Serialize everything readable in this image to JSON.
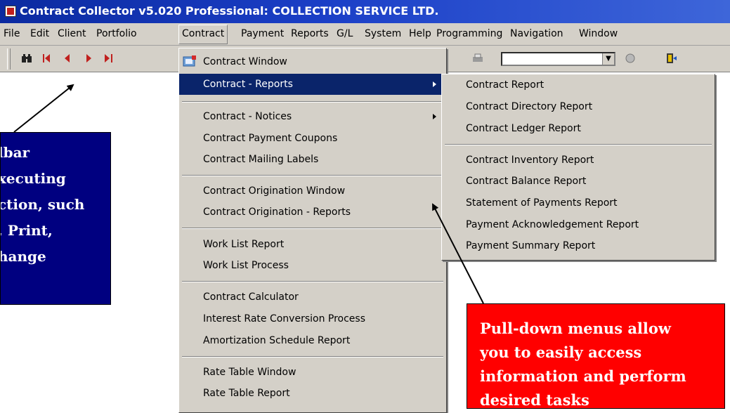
{
  "window": {
    "title": "Contract Collector v5.020 Professional: COLLECTION SERVICE LTD."
  },
  "menubar": {
    "items": [
      "File",
      "Edit",
      "Client",
      "Portfolio",
      "Contract",
      "Payment",
      "Reports",
      "G/L",
      "System",
      "Help",
      "Programming",
      "Navigation",
      "Window"
    ],
    "active": "Contract"
  },
  "toolbar": {
    "icons": [
      "binoculars-icon",
      "first-record-icon",
      "previous-record-icon",
      "next-record-icon",
      "last-record-icon"
    ],
    "combo_value": ""
  },
  "contract_menu": {
    "items": [
      {
        "label": "Contract Window",
        "submenu": false,
        "highlighted": false
      },
      {
        "label": "Contract - Reports",
        "submenu": true,
        "highlighted": true
      },
      {
        "label": "Contract - Notices",
        "submenu": true,
        "highlighted": false
      },
      {
        "label": "Contract Payment Coupons",
        "submenu": false,
        "highlighted": false
      },
      {
        "label": "Contract Mailing Labels",
        "submenu": false,
        "highlighted": false
      },
      {
        "label": "Contract Origination Window",
        "submenu": false,
        "highlighted": false
      },
      {
        "label": "Contract Origination - Reports",
        "submenu": false,
        "highlighted": false
      },
      {
        "label": "Work List Report",
        "submenu": false,
        "highlighted": false
      },
      {
        "label": "Work List Process",
        "submenu": false,
        "highlighted": false
      },
      {
        "label": "Contract Calculator",
        "submenu": false,
        "highlighted": false
      },
      {
        "label": "Interest Rate Conversion Process",
        "submenu": false,
        "highlighted": false
      },
      {
        "label": "Amortization Schedule Report",
        "submenu": false,
        "highlighted": false
      },
      {
        "label": "Rate Table Window",
        "submenu": false,
        "highlighted": false
      },
      {
        "label": "Rate Table Report",
        "submenu": false,
        "highlighted": false
      }
    ]
  },
  "reports_submenu": {
    "items": [
      "Contract Report",
      "Contract Directory Report",
      "Contract Ledger Report",
      "Contract Inventory Report",
      "Contract Balance Report",
      "Statement of Payments Report",
      "Payment Acknowledgement Report",
      "Payment Summary Report"
    ]
  },
  "callouts": {
    "toolbar_note": [
      "lbar",
      "xecuting",
      "ction, such",
      ", Print,",
      "hange"
    ],
    "menu_note": [
      "Pull-down menus allow",
      "you to easily access",
      "information and perform",
      "desired tasks"
    ]
  },
  "colors": {
    "menu_highlight": "#0a246a",
    "toolbar_note_bg": "#000080",
    "menu_note_bg": "#ff0000",
    "nav_icons": "#c0201e"
  }
}
